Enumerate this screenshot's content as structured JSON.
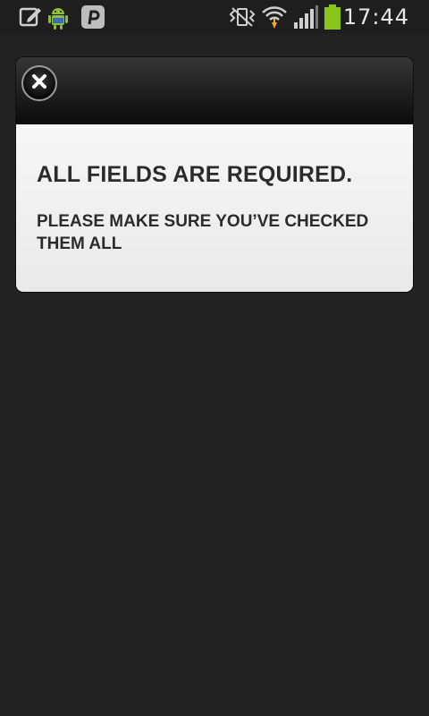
{
  "status_bar": {
    "time": "17:44",
    "notification_icons": [
      "edit-note-icon",
      "android-icon",
      "pinterest-icon"
    ],
    "system_icons": [
      "vibrate-icon",
      "wifi-icon",
      "cellular-signal-icon",
      "battery-icon"
    ],
    "battery_color": "#8ac31a"
  },
  "dialog": {
    "close_icon": "close-icon",
    "title": "ALL FIELDS ARE REQUIRED.",
    "message": "PLEASE MAKE SURE YOU’VE CHECKED THEM ALL"
  },
  "colors": {
    "background": "#222222",
    "dialog_body": "#f2f2f2",
    "text": "#2b2b2b",
    "wifi_download_arrow": "#f5a623"
  }
}
